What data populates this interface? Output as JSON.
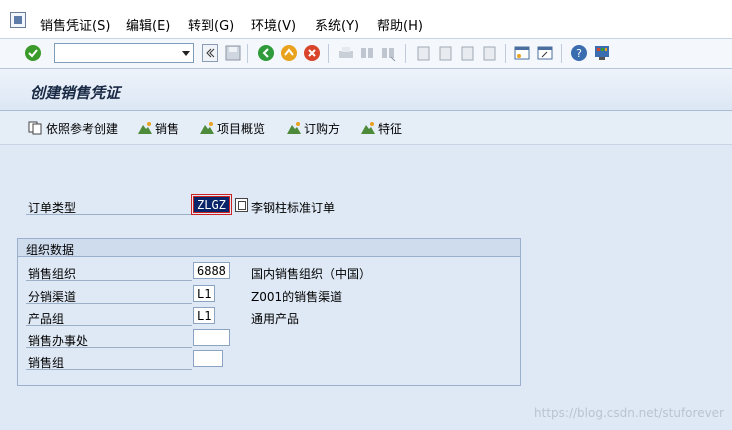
{
  "menu": {
    "items": [
      "销售凭证(S)",
      "编辑(E)",
      "转到(G)",
      "环境(V)",
      "系统(Y)",
      "帮助(H)"
    ]
  },
  "toolbar": {
    "command_value": ""
  },
  "page": {
    "title": "创建销售凭证"
  },
  "app_toolbar": {
    "buttons": [
      "依照参考创建",
      "销售",
      "项目概览",
      "订购方",
      "特征"
    ]
  },
  "order_type": {
    "label": "订单类型",
    "value": "ZLGZ",
    "description": "李钢柱标准订单"
  },
  "org_group": {
    "title": "组织数据",
    "rows": [
      {
        "label": "销售组织",
        "value": "6888",
        "description": "国内销售组织（中国）"
      },
      {
        "label": "分销渠道",
        "value": "L1",
        "description": "Z001的销售渠道"
      },
      {
        "label": "产品组",
        "value": "L1",
        "description": "通用产品"
      },
      {
        "label": "销售办事处",
        "value": "",
        "description": ""
      },
      {
        "label": "销售组",
        "value": "",
        "description": ""
      }
    ]
  },
  "watermark": "https://blog.csdn.net/stuforever",
  "colors": {
    "background": "#dfe9f5",
    "focus_field": "#0a246a",
    "focus_border": "#cc2222"
  }
}
